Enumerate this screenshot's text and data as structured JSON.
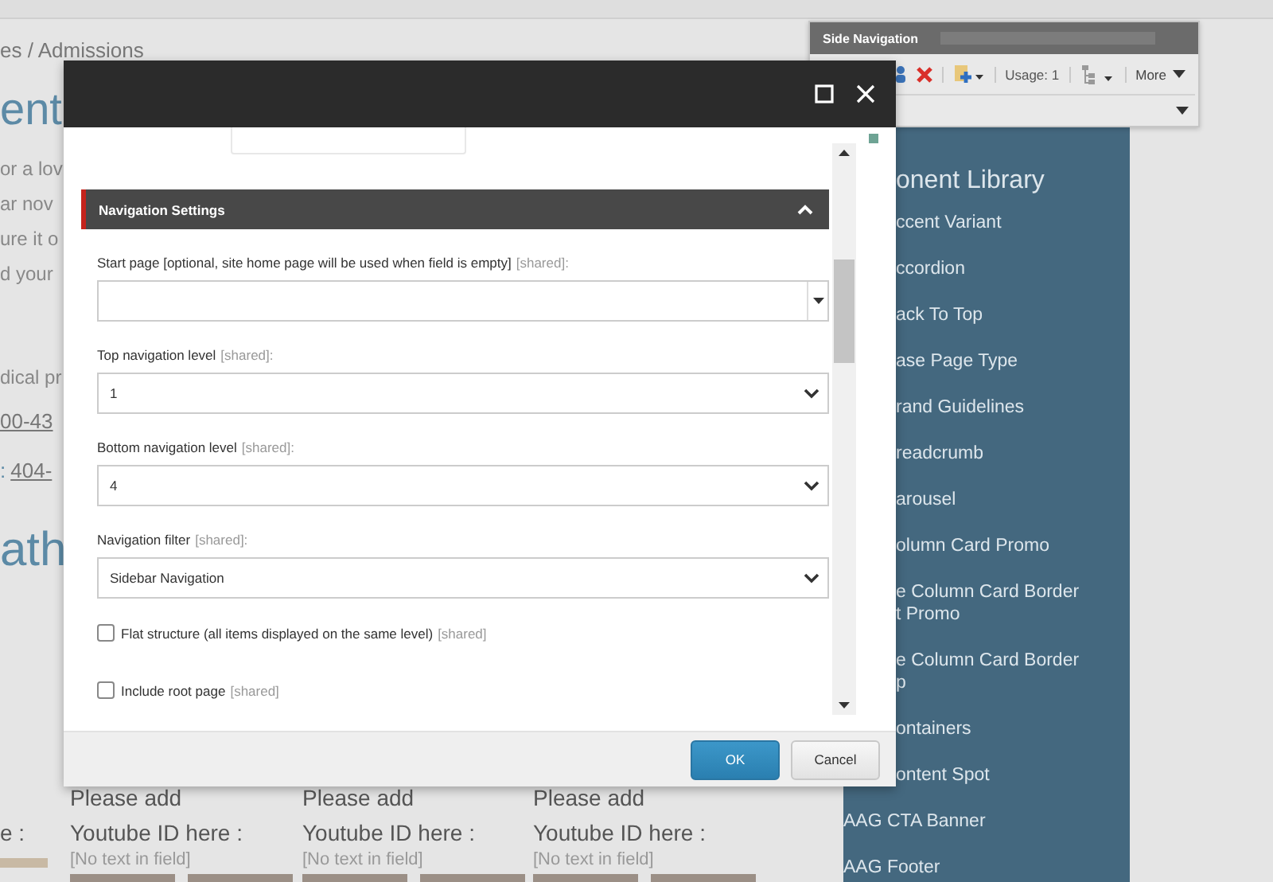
{
  "breadcrumb": "es / Admissions",
  "page": {
    "heading_1": "ent",
    "intro_lines": [
      "or a lov",
      "ar nov",
      "ure it o",
      "d your"
    ],
    "line_5": "dical pr",
    "phone_1": "00-43",
    "phone_2_label": ":",
    "phone_2": "404-",
    "heading_2": "ath",
    "label_left": "e :"
  },
  "video_blocks": [
    {
      "title": "Please add",
      "label": "Youtube ID here :",
      "placeholder": "[No text in field]"
    },
    {
      "title": "Please add",
      "label": "Youtube ID here :",
      "placeholder": "[No text in field]"
    },
    {
      "title": "Please add",
      "label": "Youtube ID here :",
      "placeholder": "[No text in field]"
    }
  ],
  "sidebar": {
    "title": "onent Library",
    "partially_hidden_items": [
      "ccent Variant",
      "ccordion",
      "ack To Top",
      "ase Page Type",
      "rand Guidelines",
      "readcrumb",
      "arousel",
      "olumn Card Promo",
      "e Column Card Border\nt Promo",
      "e Column Card Border\np",
      "ontainers",
      "ontent Spot"
    ],
    "items": [
      "AAG CTA Banner",
      "AAG Footer"
    ]
  },
  "side_navigation_panel": {
    "title": "Side Navigation",
    "usage": "Usage: 1",
    "more": "More"
  },
  "dialog": {
    "section": {
      "title": "Navigation Settings",
      "expanded": true
    },
    "fields": [
      {
        "kind": "combo",
        "label": "Start page [optional, site home page will be used when field is empty]",
        "tag": "[shared]:"
      },
      {
        "kind": "select",
        "label": "Top navigation level",
        "tag": "[shared]:",
        "value": "1"
      },
      {
        "kind": "select",
        "label": "Bottom navigation level",
        "tag": "[shared]:",
        "value": "4"
      },
      {
        "kind": "select",
        "label": "Navigation filter",
        "tag": "[shared]:",
        "value": "Sidebar Navigation"
      }
    ],
    "checkboxes": [
      {
        "label": "Flat structure (all items displayed on the same level)",
        "tag": "[shared]",
        "checked": false
      },
      {
        "label": "Include root page",
        "tag": "[shared]",
        "checked": false
      }
    ],
    "buttons": [
      {
        "label": "OK",
        "primary": true
      },
      {
        "label": "Cancel",
        "primary": false
      }
    ]
  }
}
